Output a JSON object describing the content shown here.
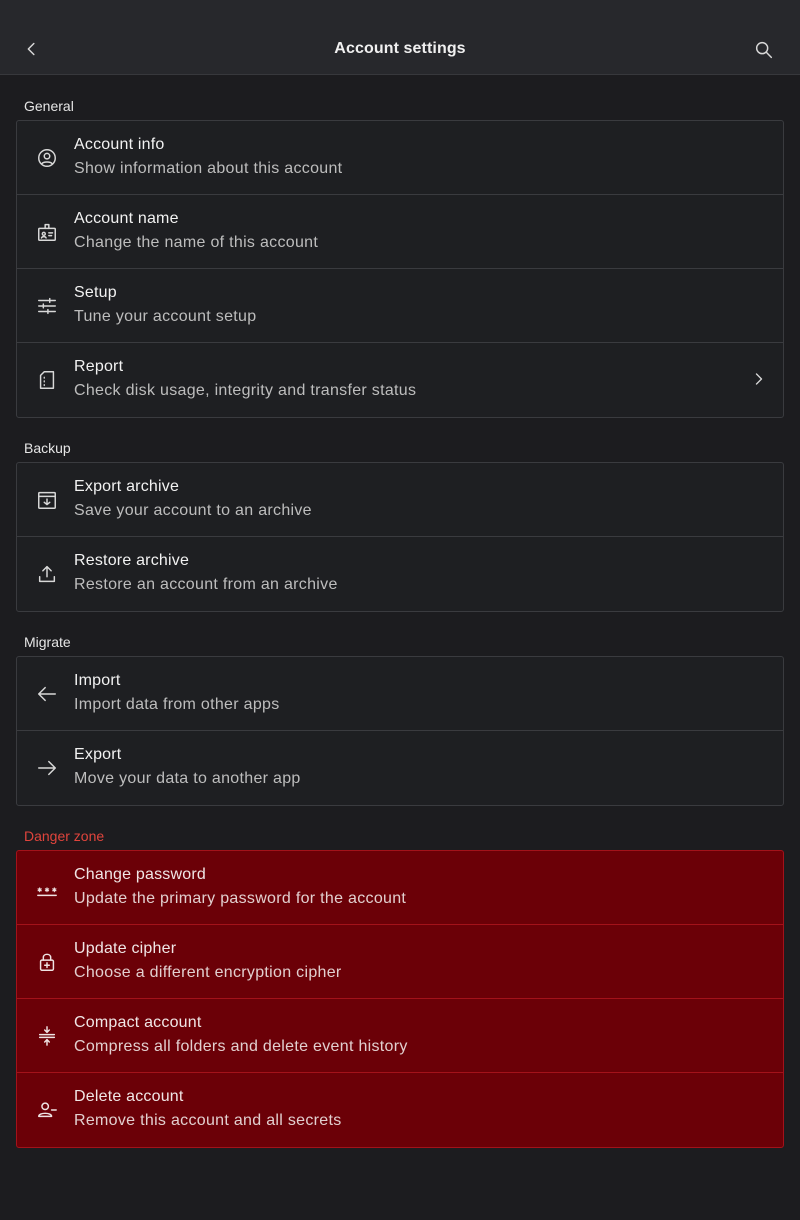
{
  "header": {
    "title": "Account settings"
  },
  "sections": {
    "general": {
      "label": "General",
      "items": [
        {
          "icon": "account-circle-icon",
          "title": "Account info",
          "subtitle": "Show information about this account"
        },
        {
          "icon": "badge-icon",
          "title": "Account name",
          "subtitle": "Change the name of this account"
        },
        {
          "icon": "sliders-icon",
          "title": "Setup",
          "subtitle": "Tune your account setup"
        },
        {
          "icon": "sd-card-icon",
          "title": "Report",
          "subtitle": "Check disk usage, integrity and transfer status"
        }
      ]
    },
    "backup": {
      "label": "Backup",
      "items": [
        {
          "icon": "archive-download-icon",
          "title": "Export archive",
          "subtitle": "Save your account to an archive"
        },
        {
          "icon": "upload-icon",
          "title": "Restore archive",
          "subtitle": "Restore an account from an archive"
        }
      ]
    },
    "migrate": {
      "label": "Migrate",
      "items": [
        {
          "icon": "arrow-left-icon",
          "title": "Import",
          "subtitle": "Import data from other apps"
        },
        {
          "icon": "arrow-right-icon",
          "title": "Export",
          "subtitle": "Move your data to another app"
        }
      ]
    },
    "danger": {
      "label": "Danger zone",
      "items": [
        {
          "icon": "password-dots-icon",
          "title": "Change password",
          "subtitle": "Update the primary password for the account"
        },
        {
          "icon": "lock-plus-icon",
          "title": "Update cipher",
          "subtitle": "Choose a different encryption cipher"
        },
        {
          "icon": "compress-icon",
          "title": "Compact account",
          "subtitle": "Compress all folders and delete event history"
        },
        {
          "icon": "person-remove-icon",
          "title": "Delete account",
          "subtitle": "Remove this account and all secrets"
        }
      ]
    }
  },
  "colors": {
    "background": "#1c1c1f",
    "danger_bg": "#6b0007",
    "danger_label": "#e0443c"
  }
}
